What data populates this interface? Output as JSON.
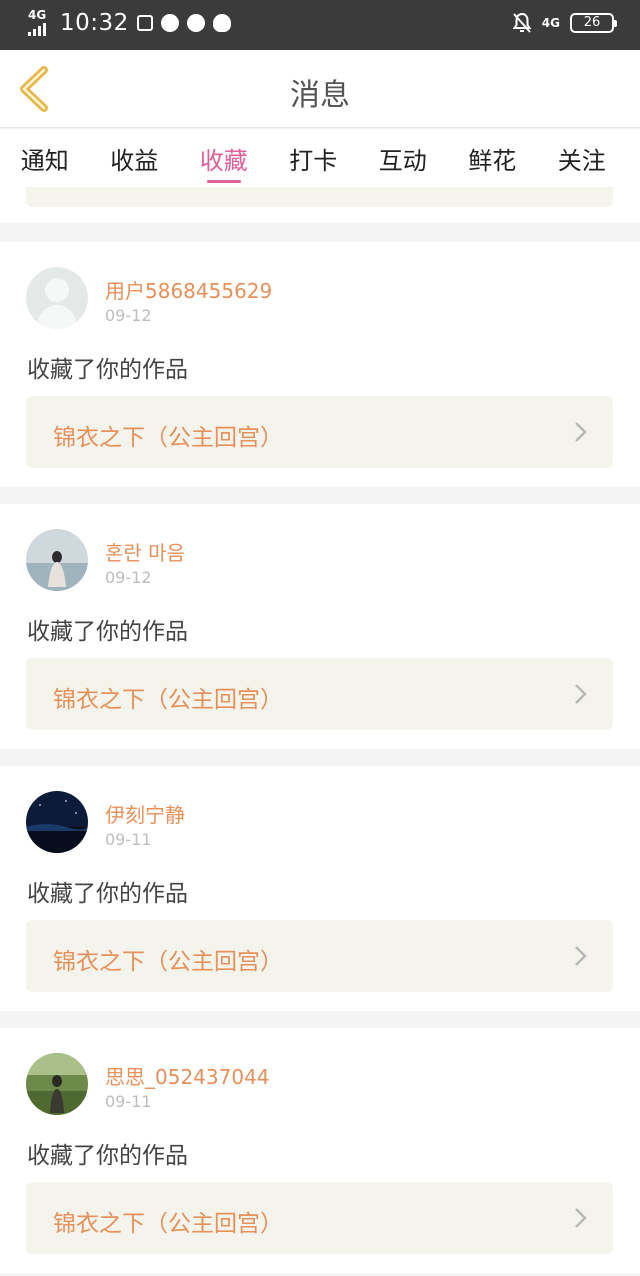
{
  "status_bar": {
    "network_left": "4G",
    "time": "10:32",
    "network_right": "4G",
    "battery": "26"
  },
  "header": {
    "title": "消息"
  },
  "tabs": [
    {
      "label": "通知"
    },
    {
      "label": "收益"
    },
    {
      "label": "收藏",
      "active": true
    },
    {
      "label": "打卡"
    },
    {
      "label": "互动"
    },
    {
      "label": "鲜花"
    },
    {
      "label": "关注"
    }
  ],
  "items": [
    {
      "username": "用户5868455629",
      "date": "09-12",
      "message": "收藏了你的作品",
      "work_title": "锦衣之下（公主回宫）"
    },
    {
      "username": "혼란 마음",
      "date": "09-12",
      "message": "收藏了你的作品",
      "work_title": "锦衣之下（公主回宫）"
    },
    {
      "username": "伊刻宁静",
      "date": "09-11",
      "message": "收藏了你的作品",
      "work_title": "锦衣之下（公主回宫）"
    },
    {
      "username": "思思_052437044",
      "date": "09-11",
      "message": "收藏了你的作品",
      "work_title": "锦衣之下（公主回宫）"
    }
  ],
  "colors": {
    "accent": "#e0609a",
    "username": "#e6905a",
    "back_arrow": "#e6b84a"
  }
}
